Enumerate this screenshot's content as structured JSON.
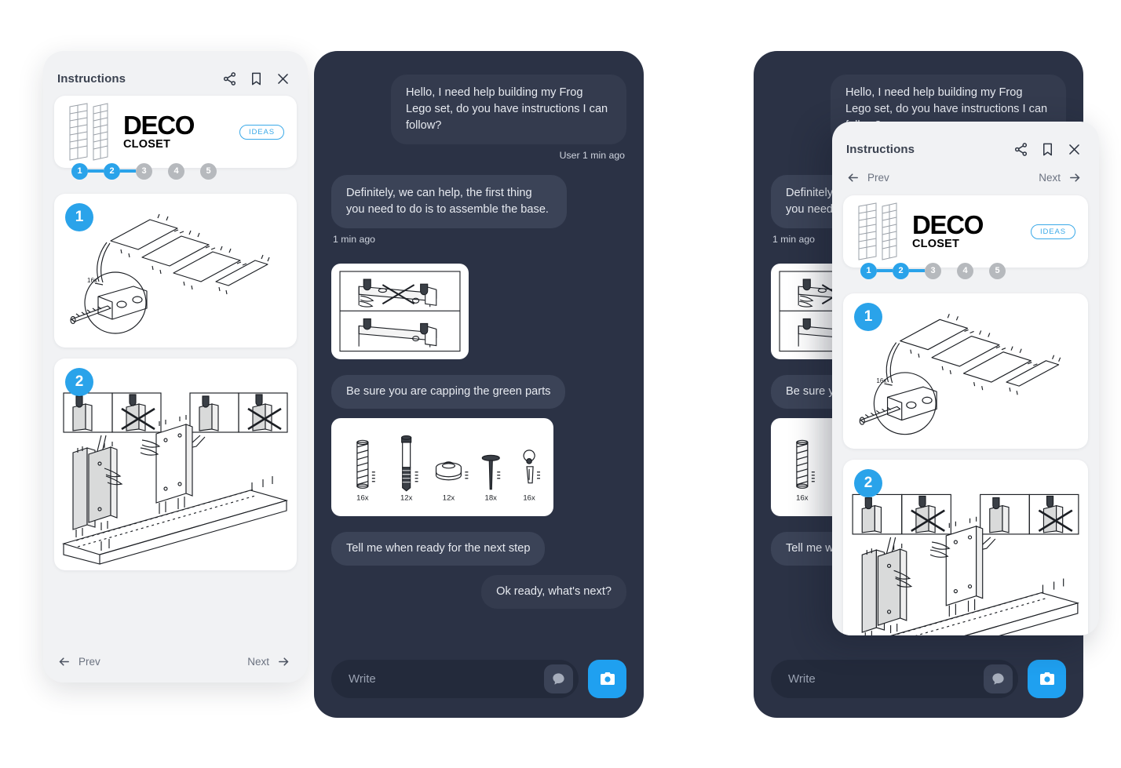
{
  "instructions": {
    "title": "Instructions",
    "icons": {
      "share": "share-icon",
      "bookmark": "bookmark-icon",
      "close": "close-icon"
    },
    "nav": {
      "prev": "Prev",
      "next": "Next"
    },
    "product": {
      "brand": "DECO",
      "subtitle": "CLOSET",
      "badge": "IDEAS"
    },
    "stepper": {
      "steps": [
        {
          "label": "1",
          "state": "active"
        },
        {
          "label": "2",
          "state": "active"
        },
        {
          "label": "3",
          "state": "idle"
        },
        {
          "label": "4",
          "state": "idle"
        },
        {
          "label": "5",
          "state": "idle"
        }
      ]
    },
    "steps": [
      {
        "number": "1",
        "qty_callout": "16x",
        "art": "shelf-panels-dowel-detail"
      },
      {
        "number": "2",
        "qty_callout": "",
        "art": "side-panels-base-assembly"
      }
    ]
  },
  "chat": {
    "messages": [
      {
        "side": "out",
        "text": "Hello, I need help building my Frog Lego set, do you have instructions I can follow?",
        "meta": "User 1 min ago"
      },
      {
        "side": "in",
        "text": "Definitely, we can help, the first thing you need to do is to assemble the base.",
        "meta": "1 min ago"
      },
      {
        "side": "in",
        "type": "image",
        "art": "cap-rail-do-dont"
      },
      {
        "side": "in",
        "text": "Be sure you are capping the green parts"
      },
      {
        "side": "in",
        "type": "image",
        "art": "hardware-parts-list"
      },
      {
        "side": "in",
        "text": "Tell me when ready for the next step"
      },
      {
        "side": "out",
        "text": "Ok ready, what's next?"
      }
    ],
    "parts": [
      {
        "name": "dowel",
        "qty": "16x"
      },
      {
        "name": "cam-bolt",
        "qty": "12x"
      },
      {
        "name": "cam-lock",
        "qty": "12x"
      },
      {
        "name": "nail",
        "qty": "18x"
      },
      {
        "name": "bracket",
        "qty": "16x"
      }
    ],
    "composer": {
      "placeholder": "Write",
      "chat_icon": "chat-bubble-icon",
      "camera_icon": "camera-icon"
    }
  },
  "colors": {
    "accent": "#2aa3ea",
    "camera": "#1fa0f0",
    "panel_dark": "#2b3245",
    "bubble_out": "#343b4e",
    "bubble_in": "#3b4357",
    "panel_light": "#f1f2f4",
    "step_idle": "#b6b9bd"
  }
}
